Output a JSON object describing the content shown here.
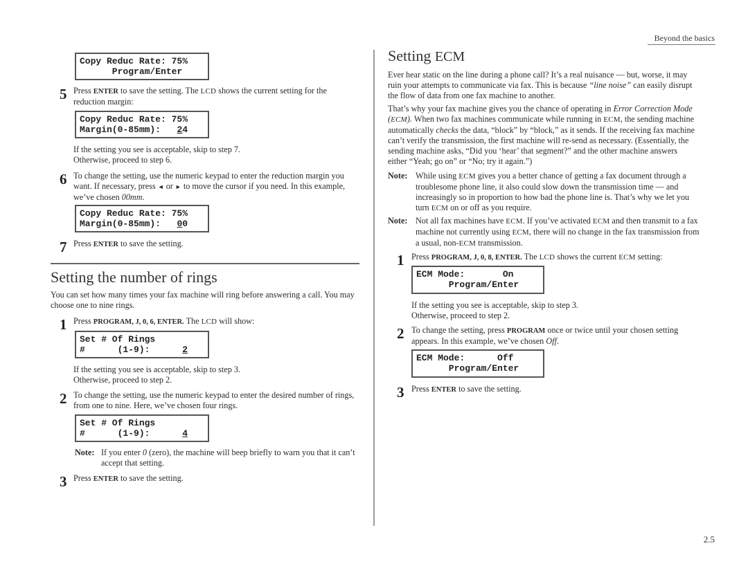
{
  "header": {
    "section_title": "Beyond the basics"
  },
  "page_number": "2.5",
  "left_column": {
    "lcd_reduc_rate_initial": {
      "line1": "Copy Reduc Rate: 75%",
      "line2": "      Program/Enter"
    },
    "step5": {
      "number": "5",
      "text_pre": "Press ",
      "key1": "ENTER",
      "text_mid": " to save the setting. The ",
      "lcd_word": "LCD",
      "text_post": " shows the current setting for the reduction margin:"
    },
    "lcd_margin_24": {
      "line1": "Copy Reduc Rate: 75%",
      "line2_prefix": "Margin(0-85mm):   ",
      "cursor_digit": "2",
      "rest_digit": "4"
    },
    "step5_followup": {
      "line1": "If the setting you see is acceptable, skip to step 7.",
      "line2": "Otherwise, proceed to step 6."
    },
    "step6": {
      "number": "6",
      "text_pre": "To change the setting, use the numeric keypad to enter the reduction margin you want. If necessary, press ",
      "left_arrow": "◄",
      "text_or": " or ",
      "right_arrow": "►",
      "text_mid": " to move the cursor if you need. In this example, we’ve chosen ",
      "chosen": "00mm",
      "text_post": "."
    },
    "lcd_margin_00": {
      "line1": "Copy Reduc Rate: 75%",
      "line2_prefix": "Margin(0-85mm):   ",
      "cursor_digit": "0",
      "rest_digit": "0"
    },
    "step7": {
      "number": "7",
      "text_pre": "Press ",
      "key1": "ENTER",
      "text_post": " to save the setting."
    },
    "rings_section": {
      "title": "Setting the number of rings",
      "intro": "You can set how many times your fax machine will ring before answering a call. You may choose one to nine rings.",
      "step1": {
        "number": "1",
        "text_pre": "Press ",
        "keys": "PROGRAM, J, 0, 6, ENTER.",
        "text_mid": " The ",
        "lcd_word": "LCD",
        "text_post": " will show:"
      },
      "lcd_rings_2": {
        "line1": "Set # Of Rings",
        "line2_prefix": "#      (1-9):      ",
        "cursor_digit": "2"
      },
      "step1_followup": {
        "line1": "If the setting you see is acceptable, skip to step 3.",
        "line2": "Otherwise, proceed to step 2."
      },
      "step2": {
        "number": "2",
        "text": "To change the setting, use the numeric keypad to enter the desired number of rings, from one to nine. Here, we’ve chosen four rings."
      },
      "lcd_rings_4": {
        "line1": "Set # Of Rings",
        "line2_prefix": "#      (1-9):      ",
        "cursor_digit": "4"
      },
      "note": {
        "label": "Note:",
        "text_pre": "If you enter ",
        "zero": "0",
        "text_post": " (zero), the machine will beep briefly to warn you that it can’t accept that setting."
      },
      "step3": {
        "number": "3",
        "text_pre": "Press ",
        "key1": "ENTER",
        "text_post": " to save the setting."
      }
    }
  },
  "right_column": {
    "title_main": "Setting ",
    "title_sc": "ECM",
    "para1_pre": "Ever hear static on the line during a phone call? It’s a real nuisance — but, worse, it may ruin your attempts to communicate via fax. This is because ",
    "para1_italic": "“line noise”",
    "para1_post": " can easily disrupt the flow of data from one fax machine to another.",
    "para2": {
      "t1": "That’s why your fax machine gives you the chance of operating in ",
      "i1": "Error Correction Mode (",
      "sc1": "ECM",
      "i1_close": ").",
      "t2": " When two fax machines communicate while running in ",
      "sc2": "ECM",
      "t3": ", the sending machine automatically ",
      "i2": "checks",
      "t4": " the data, “block” by “block,” as it sends. If the receiving fax machine can’t verify the transmission, the first machine will re-send as necessary. (Essentially, the sending machine asks, “Did you ‘hear’ that segment?” and the other machine answers either “Yeah; go on” or “No; try it again.”)"
    },
    "note1": {
      "label": "Note:",
      "t1": "While using ",
      "sc1": "ECM",
      "t2": " gives you a better chance of getting a fax document through a troublesome phone line, it also could slow down the transmission time — and increasingly so in proportion to how bad the phone line is. That’s why we let you turn ",
      "sc2": "ECM",
      "t3": " on or off as you require."
    },
    "note2": {
      "label": "Note:",
      "t1": "Not all fax machines have ",
      "sc1": "ECM",
      "t2": ". If you’ve activated ",
      "sc2": "ECM",
      "t3": " and then transmit to a fax machine not currently using ",
      "sc3": "ECM",
      "t4": ", there will no change in the fax transmission from a usual, non-",
      "sc4": "ECM",
      "t5": " transmission."
    },
    "step1": {
      "number": "1",
      "text_pre": "Press ",
      "keys": "PROGRAM, J, 0, 8, ENTER.",
      "text_mid": " The ",
      "lcd_word": "LCD",
      "text_mid2": " shows the current ",
      "ecm_word": "ECM",
      "text_post": " setting:"
    },
    "lcd_ecm_on": {
      "line1": "ECM Mode:       On",
      "line2": "      Program/Enter"
    },
    "step1_followup": {
      "line1": "If the setting you see is acceptable, skip to step 3.",
      "line2": "Otherwise, proceed to step 2."
    },
    "step2": {
      "number": "2",
      "text_pre": "To change the setting, press ",
      "key1": "PROGRAM",
      "text_mid": " once or twice until your chosen setting appears. In this example, we’ve chosen ",
      "chosen": "Off",
      "text_post": "."
    },
    "lcd_ecm_off": {
      "line1": "ECM Mode:      Off",
      "line2": "      Program/Enter"
    },
    "step3": {
      "number": "3",
      "text_pre": "Press ",
      "key1": "ENTER",
      "text_post": " to save the setting."
    }
  }
}
